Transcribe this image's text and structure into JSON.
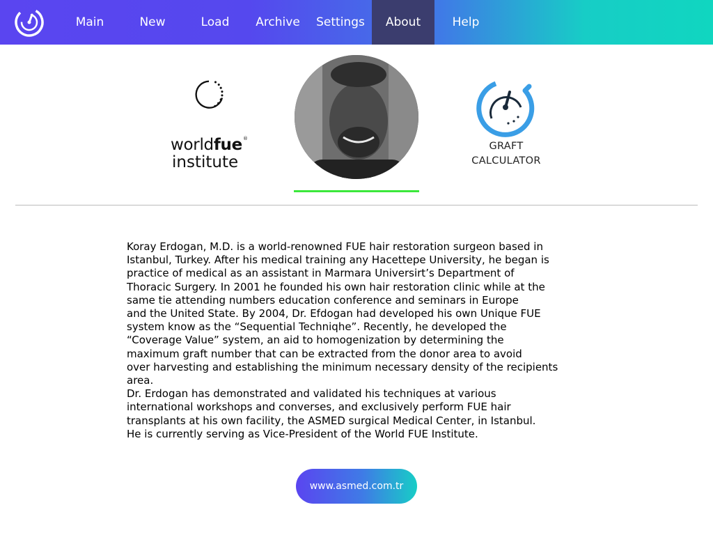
{
  "nav": {
    "items": [
      {
        "label": "Main"
      },
      {
        "label": "New"
      },
      {
        "label": "Load"
      },
      {
        "label": "Archive"
      },
      {
        "label": "Settings"
      },
      {
        "label": "About",
        "active": true
      },
      {
        "label": "Help"
      }
    ]
  },
  "header": {
    "wfi_logo": {
      "line1_light": "world",
      "line1_bold": "fue",
      "reg_mark": "®",
      "line2": "institute"
    },
    "graft_logo": {
      "line1": "GRAFT",
      "line2": "CALCULATOR"
    }
  },
  "bio": {
    "text": "Koray Erdogan, M.D. is a world-renowned FUE hair restoration surgeon based in\nIstanbul, Turkey. After his medical training any Hacettepe University, he began is\npractice of medical as an assistant in Marmara Universirt’s Department of\nThoracic Surgery. In 2001 he founded his own hair restoration clinic while at the\nsame tie attending numbers education conference and seminars in Europe\nand the United State. By 2004, Dr. Efdogan had developed his own Unique FUE\nsystem know as the “Sequential Techniqhe”. Recently, he developed the\n“Coverage Value” system, an aid to homogenization by determining the\nmaximum graft number that can be extracted from the donor area to avoid\nover harvesting and establishing the minimum necessary density of the recipients\narea.\nDr. Erdogan has demonstrated and validated his techniques at various\ninternational workshops and converses, and exclusively perform FUE hair\ntransplants at his own facility, the ASMED surgical Medical Center, in Istanbul.\nHe is currently serving as Vice-President of the World FUE Institute."
  },
  "website_button": {
    "label": "www.asmed.com.tr"
  },
  "colors": {
    "nav_gradient_start": "#5a45f0",
    "nav_gradient_end": "#10d6c0",
    "nav_active": "#3b3d6e",
    "accent_blue": "#3a9ee6",
    "underline_green": "#3be83b"
  }
}
